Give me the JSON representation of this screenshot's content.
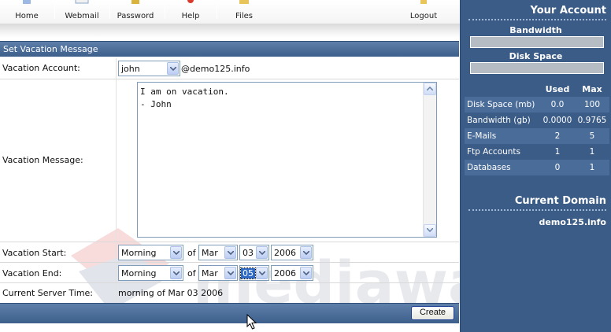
{
  "nav": {
    "items": [
      {
        "label": "Home",
        "icon": "home-icon"
      },
      {
        "label": "Webmail",
        "icon": "webmail-icon"
      },
      {
        "label": "Password",
        "icon": "password-icon"
      },
      {
        "label": "Help",
        "icon": "help-icon"
      },
      {
        "label": "Files",
        "icon": "files-icon"
      },
      {
        "label": "Logout",
        "icon": "logout-icon"
      }
    ]
  },
  "form": {
    "title": "Set Vacation Message",
    "account": {
      "label": "Vacation Account:",
      "value": "john",
      "domain": "@demo125.info"
    },
    "message": {
      "label": "Vacation Message:",
      "value": "I am on vacation.\n- John"
    },
    "start": {
      "label": "Vacation Start:",
      "time": "Morning",
      "of": "of",
      "month": "Mar",
      "day": "03",
      "year": "2006"
    },
    "end": {
      "label": "Vacation End:",
      "time": "Morning",
      "of": "of",
      "month": "Mar",
      "day": "05",
      "year": "2006"
    },
    "server_time": {
      "label": "Current Server Time:",
      "value": "morning of Mar 03 2006"
    },
    "create_label": "Create"
  },
  "sidebar": {
    "title": "Your Account",
    "bandwidth_label": "Bandwidth",
    "bandwidth_fill": 0.0,
    "diskspace_label": "Disk Space",
    "diskspace_fill": 0.0,
    "stats": {
      "headers": [
        "Used",
        "Max"
      ],
      "rows": [
        {
          "name": "Disk Space (mb)",
          "used": "0.0",
          "max": "100"
        },
        {
          "name": "Bandwidth (gb)",
          "used": "0.0000",
          "max": "0.9765"
        },
        {
          "name": "E-Mails",
          "used": "2",
          "max": "5"
        },
        {
          "name": "Ftp Accounts",
          "used": "1",
          "max": "1"
        },
        {
          "name": "Databases",
          "used": "0",
          "max": "1"
        }
      ]
    },
    "current_domain_title": "Current Domain",
    "current_domain": "demo125.info"
  },
  "watermark": {
    "text": "mediawax"
  },
  "colors": {
    "panel_blue": "#3b5c87",
    "header_blue": "#4a6d99",
    "accent_orange": "#e2a33a"
  }
}
